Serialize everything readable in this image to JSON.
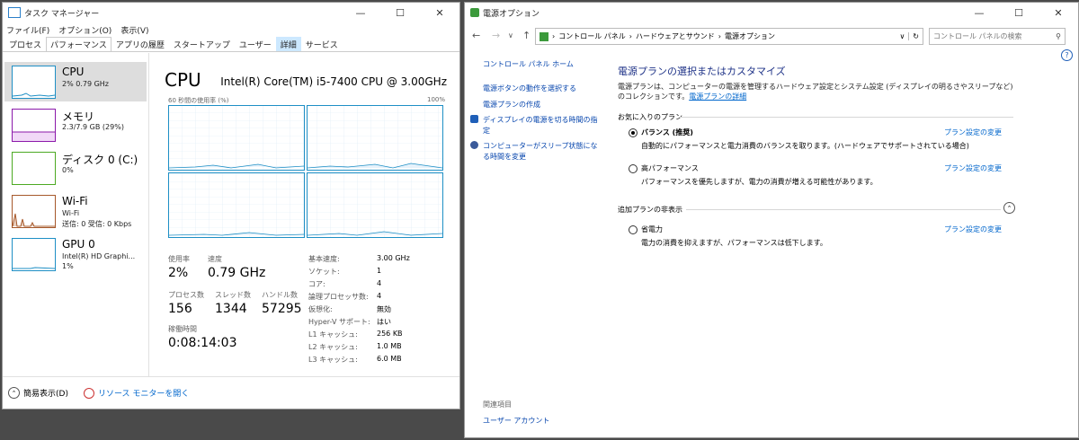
{
  "taskmgr": {
    "title": "タスク マネージャー",
    "menu": [
      "ファイル(F)",
      "オプション(O)",
      "表示(V)"
    ],
    "tabs": [
      "プロセス",
      "パフォーマンス",
      "アプリの履歴",
      "スタートアップ",
      "ユーザー",
      "詳細",
      "サービス"
    ],
    "side_items": [
      {
        "name": "CPU",
        "sub1": "2% 0.79 GHz",
        "sub2": "",
        "color": "#1e8fc5"
      },
      {
        "name": "メモリ",
        "sub1": "2.3/7.9 GB (29%)",
        "sub2": "",
        "color": "#8b18aa"
      },
      {
        "name": "ディスク 0 (C:)",
        "sub1": "0%",
        "sub2": "",
        "color": "#4ca922"
      },
      {
        "name": "Wi-Fi",
        "sub1": "Wi-Fi",
        "sub2": "送信: 0 受信: 0 Kbps",
        "color": "#a6582a"
      },
      {
        "name": "GPU 0",
        "sub1": "Intel(R) HD Graphi...",
        "sub2": "1%",
        "color": "#1e8fc5"
      }
    ],
    "main": {
      "title": "CPU",
      "cpu_name": "Intel(R) Core(TM) i5-7400 CPU @ 3.00GHz",
      "graph_label_left": "60 秒間の使用率 (%)",
      "graph_label_right": "100%",
      "usage_label": "使用率",
      "usage_value": "2%",
      "speed_label": "速度",
      "speed_value": "0.79 GHz",
      "process_label": "プロセス数",
      "process_value": "156",
      "thread_label": "スレッド数",
      "thread_value": "1344",
      "handle_label": "ハンドル数",
      "handle_value": "57295",
      "uptime_label": "稼働時間",
      "uptime_value": "0:08:14:03",
      "specs": [
        {
          "k": "基本速度:",
          "v": "3.00 GHz"
        },
        {
          "k": "ソケット:",
          "v": "1"
        },
        {
          "k": "コア:",
          "v": "4"
        },
        {
          "k": "論理プロセッサ数:",
          "v": "4"
        },
        {
          "k": "仮想化:",
          "v": "無効"
        },
        {
          "k": "Hyper-V サポート:",
          "v": "はい"
        },
        {
          "k": "L1 キャッシュ:",
          "v": "256 KB"
        },
        {
          "k": "L2 キャッシュ:",
          "v": "1.0 MB"
        },
        {
          "k": "L3 キャッシュ:",
          "v": "6.0 MB"
        }
      ]
    },
    "footer": {
      "fewer": "簡易表示(D)",
      "resmon": "リソース モニターを開く"
    }
  },
  "power": {
    "title": "電源オプション",
    "breadcrumb": [
      "コントロール パネル",
      "ハードウェアとサウンド",
      "電源オプション"
    ],
    "search_placeholder": "コントロール パネルの検索",
    "left_nav": [
      "コントロール パネル ホーム",
      "電源ボタンの動作を選択する",
      "電源プランの作成",
      "ディスプレイの電源を切る時間の指定",
      "コンピューターがスリープ状態になる時間を変更"
    ],
    "related_label": "関連項目",
    "related_link": "ユーザー アカウント",
    "heading": "電源プランの選択またはカスタマイズ",
    "desc": "電源プランは、コンピューターの電源を管理するハードウェア設定とシステム設定 (ディスプレイの明るさやスリープなど) のコレクションです。",
    "desc_link": "電源プランの詳細",
    "fav_header": "お気に入りのプラン",
    "extra_header": "追加プランの非表示",
    "change_link": "プラン設定の変更",
    "plans": [
      {
        "name": "バランス (推奨)",
        "desc": "自動的にパフォーマンスと電力消費のバランスを取ります。(ハードウェアでサポートされている場合)",
        "selected": true
      },
      {
        "name": "高パフォーマンス",
        "desc": "パフォーマンスを優先しますが、電力の消費が増える可能性があります。",
        "selected": false
      },
      {
        "name": "省電力",
        "desc": "電力の消費を抑えますが、パフォーマンスは低下します。",
        "selected": false
      }
    ]
  }
}
